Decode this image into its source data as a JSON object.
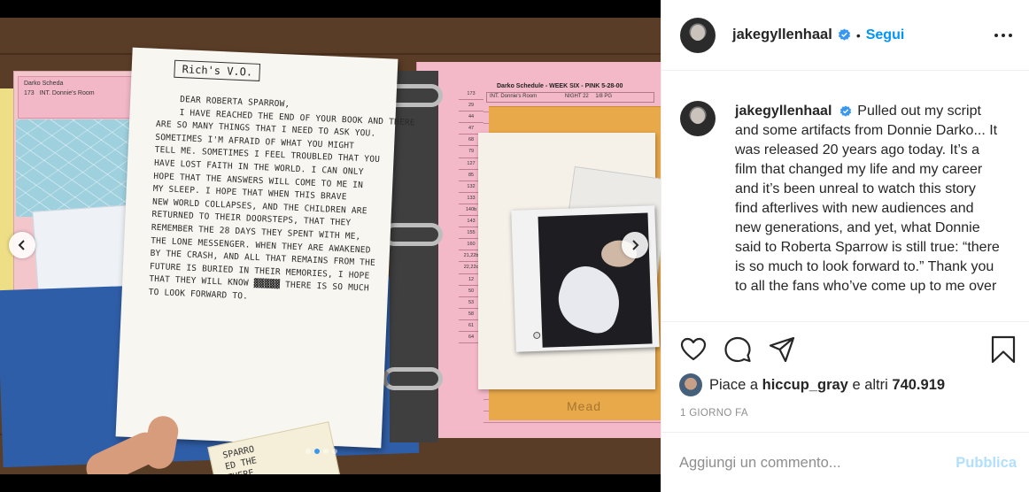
{
  "post": {
    "username": "jakegyllenhaal",
    "separator": "•",
    "follow_label": "Segui",
    "caption": "Pulled out my script and some artifacts from Donnie Darko... It was released 20 years ago today. It’s a film that changed my life and my career and it’s been unreal to watch this story find afterlives with new audiences and new generations, and yet, what Donnie said to Roberta Sparrow is still true: “there is so much to look forward to.” Thank you to all the fans who’ve come up to me over",
    "likes_prefix": "Piace a",
    "liked_by_user": "hiccup_gray",
    "likes_middle": "e altri",
    "likes_count": "740.919",
    "date": "1 GIORNO FA",
    "comment_placeholder": "Aggiungi un commento...",
    "publish_label": "Pubblica"
  },
  "media": {
    "letter_title": "Rich's V.O.",
    "letter_lines": [
      "Dear Roberta Sparrow,",
      "I have reached the end of your book and there",
      "are so many things that I need to ask you.",
      "Sometimes I'm afraid of what you might",
      "tell me. Sometimes I feel troubled that you",
      "have lost faith in the world. I can only",
      "hope that the answers will come to me in",
      "my sleep. I hope that when this brave",
      "new world collapses, and the children are",
      "returned to their doorsteps, that they",
      "remember the 28 days they spent with me,",
      "the lone messenger. When they are awakened",
      "by the crash, and all that remains from the",
      "future is buried in their memories, I hope",
      "that they will know ▓▓▓▓▓ there is so much",
      "to look forward to."
    ],
    "schedule_header": "Darko Schedule - WEEK SIX - PINK 5-28-00",
    "schedule_scene": "INT. Donnie's Room",
    "schedule_night": "NIGHT 22",
    "schedule_pages": "1/8 PG",
    "schedule_scenes": [
      "173",
      "29",
      "44",
      "47",
      "68",
      "79",
      "127",
      "85",
      "132",
      "133",
      "140b",
      "143",
      "155",
      "160",
      "21,22b",
      "22,22c",
      "12",
      "50",
      "53",
      "58",
      "61",
      "64"
    ],
    "binder_brand": "Mead",
    "small_sheet_scene": "173",
    "small_sheet_title": "Darko Scheda",
    "small_sheet_loc": "INT. Donnie's Room",
    "note_card_text": [
      "SPARRO",
      "ED THE",
      "THERE",
      "DOESN"
    ],
    "carousel": {
      "total": 4,
      "active": 2
    }
  },
  "colors": {
    "accent": "#0095f6",
    "publish_disabled": "#b2dffc",
    "carousel_active": "#3897f0",
    "verified": "#3897f0"
  }
}
